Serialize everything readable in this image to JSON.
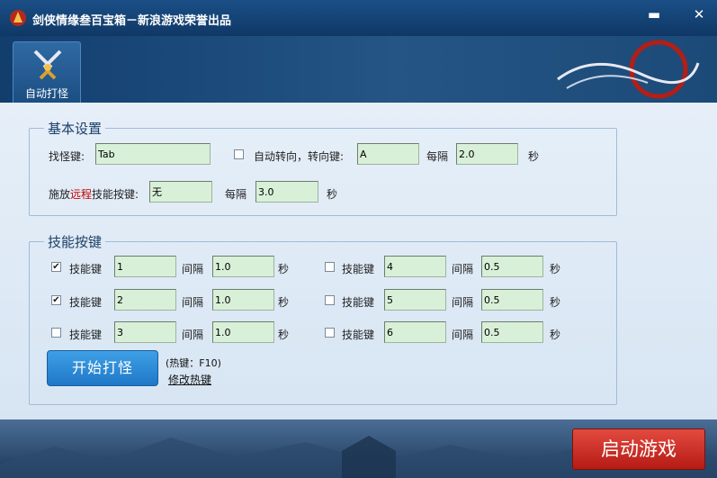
{
  "window": {
    "title": "剑侠情缘叁百宝箱－新浪游戏荣誉出品",
    "minimize_symbol": "▬",
    "close_symbol": "✕"
  },
  "toolbar": {
    "auto_fight_label": "自动打怪"
  },
  "basic": {
    "legend": "基本设置",
    "find_key_label": "找怪键:",
    "find_key_value": "Tab",
    "auto_turn_label": "自动转向，转向键:",
    "turn_key_value": "A",
    "every_label": "每隔",
    "turn_interval_value": "2.0",
    "sec_label": "秒",
    "cast_label_pre": "施放",
    "cast_label_red": "远程",
    "cast_label_post": "技能按键:",
    "cast_key_value": "无",
    "cast_interval_value": "3.0"
  },
  "skills": {
    "legend": "技能按键",
    "key_label": "技能键",
    "interval_label": "间隔",
    "sec_label": "秒",
    "rows": [
      {
        "checked": true,
        "key": "1",
        "interval": "1.0"
      },
      {
        "checked": true,
        "key": "2",
        "interval": "1.0"
      },
      {
        "checked": false,
        "key": "3",
        "interval": "1.0"
      },
      {
        "checked": false,
        "key": "4",
        "interval": "0.5"
      },
      {
        "checked": false,
        "key": "5",
        "interval": "0.5"
      },
      {
        "checked": false,
        "key": "6",
        "interval": "0.5"
      }
    ],
    "start_button": "开始打怪",
    "hotkey_text": "(热键：F10)",
    "edit_hotkey": "修改热键"
  },
  "footer": {
    "launch_button": "启动游戏"
  },
  "colors": {
    "accent": "#1f77c6",
    "launch": "#c8261e",
    "input_bg": "#d8f0d8"
  }
}
